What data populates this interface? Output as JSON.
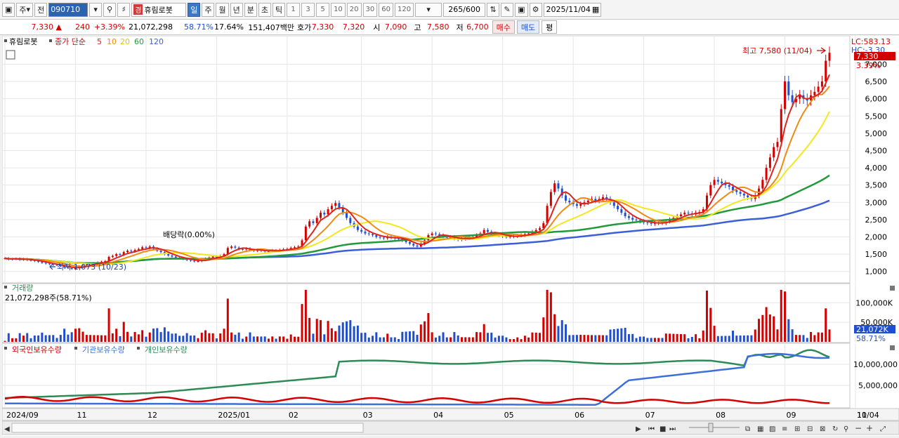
{
  "toolbar": {
    "period_label": "주",
    "prev_label": "전",
    "code": "090710",
    "stock_name": "휴림로봇",
    "name_badge": "경",
    "intervals": [
      "일",
      "주",
      "월",
      "년",
      "분",
      "초",
      "틱"
    ],
    "active_interval": "일",
    "minutes": [
      "1",
      "3",
      "5",
      "10",
      "20",
      "30",
      "60",
      "120"
    ],
    "count": "265",
    "count_max": "/600",
    "date": "2025/11/04"
  },
  "quote": {
    "price": "7,330",
    "arrow": "▲",
    "change": "240",
    "change_pct": "+3.39%",
    "volume": "21,072,298",
    "volume_pct": "58.71%",
    "turnover": "17.64%",
    "amount": "151,407백만",
    "bid_label": "호가",
    "ask": "7,330",
    "bid": "7,320",
    "open_label": "시",
    "open": "7,090",
    "high_label": "고",
    "high": "7,580",
    "low_label": "저",
    "low": "6,700",
    "buy_label": "매수",
    "sell_label": "매도",
    "eval_label": "평"
  },
  "colors": {
    "ma5": "#e0241c",
    "ma10": "#f08a14",
    "ma20": "#f2e81e",
    "ma60": "#219a3a",
    "ma120": "#3c5fd8",
    "up": "#d40000",
    "down": "#1f4fd0",
    "foreign": "#d40000",
    "institution": "#3c6fd8",
    "individual": "#2e8b57"
  },
  "price_panel": {
    "legend_name": "휴림로봇",
    "legend_ma_label": "종가 단순",
    "ma_periods": [
      "5",
      "10",
      "20",
      "60",
      "120"
    ],
    "max_annotation": "최고 7,580 (11/04)",
    "min_annotation": "최저 1,073 (10/23)",
    "dividend_annotation": "배당락(0.00%)",
    "lc_label": "LC:583.13",
    "hc_label": "HC:-3.30",
    "price_tag": "7,330",
    "pct_tag": "3.39%"
  },
  "volume_panel": {
    "title": "거래량",
    "subtitle": "21,072,298주(58.71%)",
    "tag": "21,072K",
    "tag_pct": "58.71%"
  },
  "holding_panel": {
    "series_names": [
      "외국인보유수량",
      "기관보유수량",
      "개인보유수량"
    ]
  },
  "chart_data": {
    "type": "line",
    "x_labels": [
      "2024/09",
      "11",
      "12",
      "2025/01",
      "02",
      "03",
      "04",
      "05",
      "06",
      "07",
      "08",
      "09",
      "10",
      "11",
      "11/04"
    ],
    "price_axis": {
      "ticks": [
        "1,000",
        "1,500",
        "2,000",
        "2,500",
        "3,000",
        "3,500",
        "4,000",
        "4,500",
        "5,000",
        "5,500",
        "6,000",
        "6,500",
        "7,000"
      ],
      "range": [
        750,
        7700
      ]
    },
    "volume_axis": {
      "ticks": [
        "100,000K",
        "50,000K"
      ],
      "range": [
        0,
        140000
      ]
    },
    "holding_axis": {
      "ticks": [
        "10,000,000",
        "5,000,000"
      ],
      "range": [
        0,
        14000000
      ]
    },
    "close": [
      1380,
      1350,
      1360,
      1370,
      1340,
      1360,
      1330,
      1320,
      1300,
      1280,
      1250,
      1230,
      1210,
      1190,
      1180,
      1160,
      1120,
      1100,
      1073,
      1110,
      1150,
      1180,
      1200,
      1220,
      1240,
      1260,
      1280,
      1300,
      1420,
      1450,
      1500,
      1480,
      1560,
      1600,
      1580,
      1620,
      1650,
      1700,
      1680,
      1720,
      1660,
      1600,
      1560,
      1500,
      1460,
      1430,
      1400,
      1380,
      1360,
      1330,
      1310,
      1290,
      1300,
      1330,
      1370,
      1400,
      1430,
      1420,
      1450,
      1500,
      1680,
      1720,
      1690,
      1650,
      1640,
      1660,
      1620,
      1600,
      1620,
      1600,
      1580,
      1590,
      1610,
      1600,
      1620,
      1640,
      1650,
      1680,
      1700,
      1720,
      1900,
      2300,
      2450,
      2400,
      2550,
      2700,
      2650,
      2800,
      2900,
      2980,
      2850,
      2700,
      2550,
      2400,
      2300,
      2200,
      2150,
      2100,
      2080,
      2050,
      2000,
      1980,
      1960,
      2000,
      1980,
      1960,
      1950,
      1900,
      1850,
      1800,
      1750,
      1720,
      1800,
      1900,
      2050,
      2100,
      2080,
      2050,
      2000,
      1980,
      2000,
      1950,
      1920,
      1940,
      1960,
      1980,
      2000,
      2050,
      2100,
      2200,
      2150,
      2100,
      2080,
      2050,
      2020,
      2000,
      2010,
      2020,
      2040,
      2050,
      2080,
      2100,
      2150,
      2200,
      2250,
      2400,
      2900,
      3300,
      3550,
      3400,
      3200,
      3050,
      3000,
      2950,
      2900,
      2950,
      3000,
      3050,
      3100,
      3050,
      3100,
      3150,
      3100,
      3000,
      2900,
      2800,
      2700,
      2600,
      2550,
      2500,
      2480,
      2450,
      2420,
      2400,
      2380,
      2400,
      2420,
      2400,
      2450,
      2500,
      2550,
      2600,
      2650,
      2700,
      2680,
      2650,
      2700,
      2720,
      2800,
      3200,
      3500,
      3650,
      3600,
      3550,
      3500,
      3450,
      3350,
      3300,
      3250,
      3200,
      3150,
      3100,
      3200,
      3400,
      3650,
      4000,
      4300,
      4600,
      4750,
      5700,
      6500,
      6100,
      5900,
      6000,
      6100,
      6000,
      5950,
      6100,
      6200,
      6350,
      6500,
      7100,
      7330
    ]
  }
}
